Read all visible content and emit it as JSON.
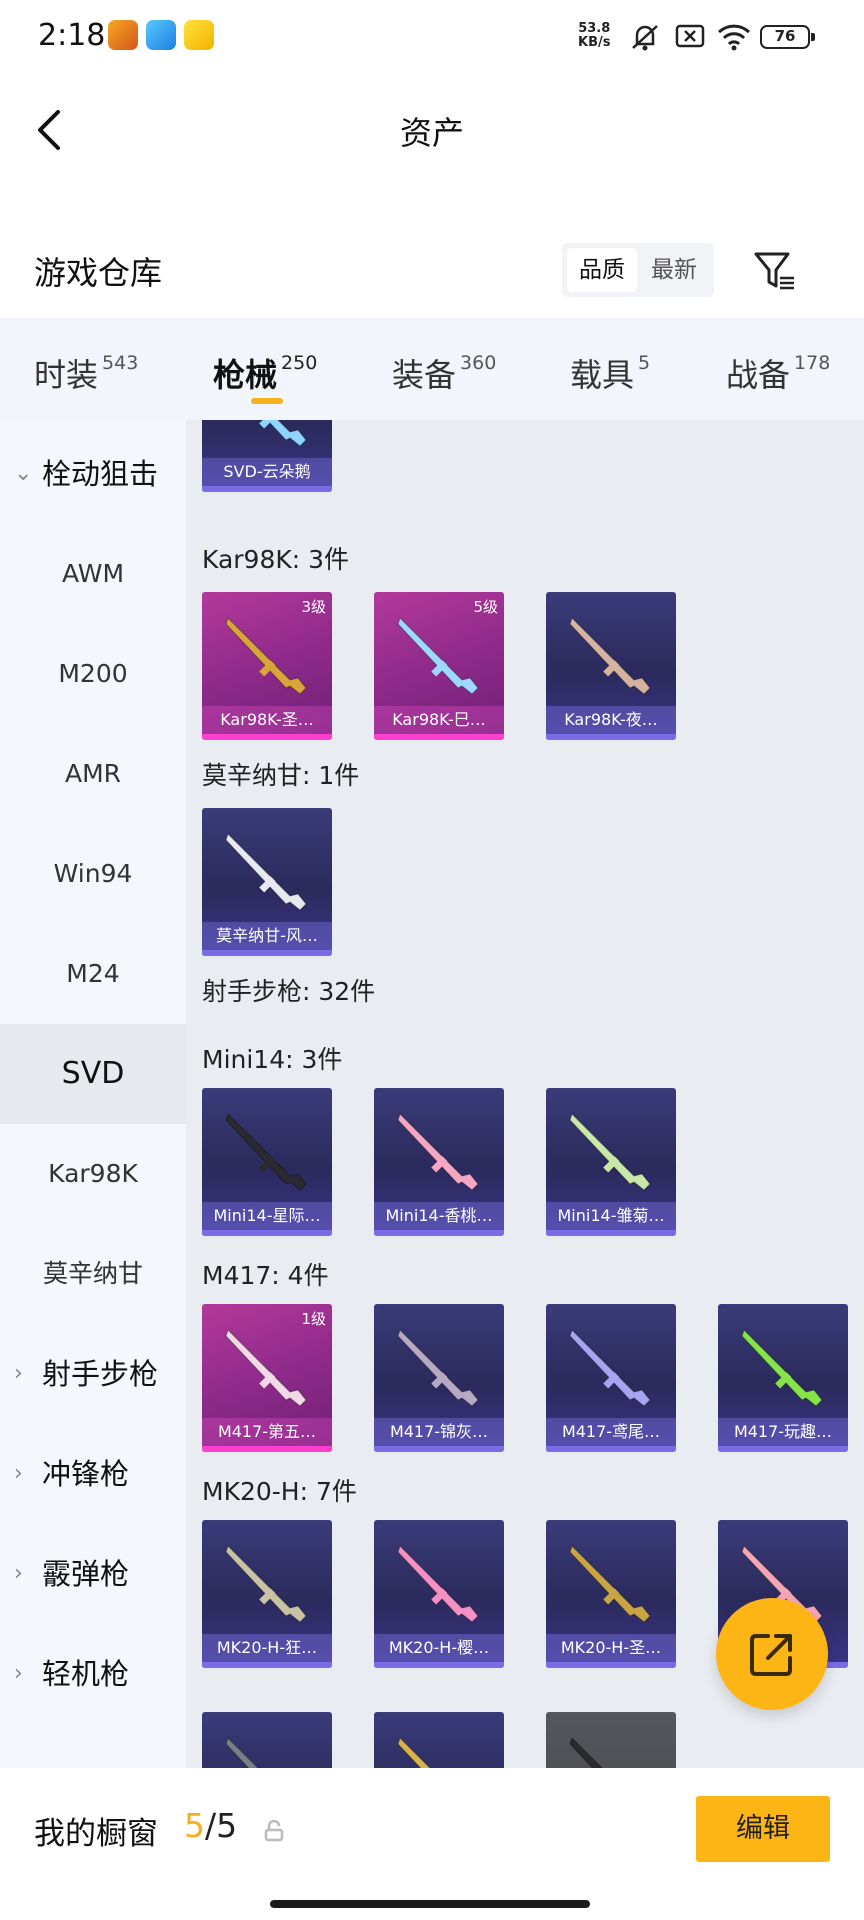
{
  "status_bar": {
    "time": "2:18",
    "net_speed_value": "53.8",
    "net_speed_unit": "KB/s",
    "battery": "76"
  },
  "header": {
    "title": "资产"
  },
  "warehouse": {
    "title": "游戏仓库",
    "sort_options": [
      "品质",
      "最新"
    ],
    "sort_active": "品质"
  },
  "tabs": [
    {
      "label": "时装",
      "count": "543"
    },
    {
      "label": "枪械",
      "count": "250",
      "active": true
    },
    {
      "label": "装备",
      "count": "360"
    },
    {
      "label": "载具",
      "count": "5"
    },
    {
      "label": "战备",
      "count": "178"
    }
  ],
  "sidebar": [
    {
      "label": "栓动狙击",
      "type": "group"
    },
    {
      "label": "AWM"
    },
    {
      "label": "M200"
    },
    {
      "label": "AMR"
    },
    {
      "label": "Win94"
    },
    {
      "label": "M24"
    },
    {
      "label": "SVD",
      "active": true
    },
    {
      "label": "Kar98K"
    },
    {
      "label": "莫辛纳甘"
    },
    {
      "label": "射手步枪",
      "type": "group"
    },
    {
      "label": "冲锋枪",
      "type": "group"
    },
    {
      "label": "霰弹枪",
      "type": "group"
    },
    {
      "label": "轻机枪",
      "type": "group"
    }
  ],
  "content": {
    "labels": [
      "Kar98K: 3件",
      "莫辛纳甘: 1件",
      "射手步枪: 32件",
      "Mini14: 3件",
      "M417: 4件",
      "MK20-H: 7件"
    ],
    "cards": [
      {
        "name": "SVD-云朵鹅",
        "style": "purple",
        "color": "#8fd3ff"
      },
      {
        "name": "Kar98K-圣…",
        "style": "pink",
        "level": "3级",
        "color": "#d9a43a"
      },
      {
        "name": "Kar98K-巳…",
        "style": "pink",
        "level": "5级",
        "color": "#9fd8ff"
      },
      {
        "name": "Kar98K-夜…",
        "style": "purple",
        "color": "#d6b2a0"
      },
      {
        "name": "莫辛纳甘-风…",
        "style": "purple",
        "color": "#e8e8f0"
      },
      {
        "name": "Mini14-星际…",
        "style": "purple",
        "color": "#2a2a30"
      },
      {
        "name": "Mini14-香桃…",
        "style": "purple",
        "color": "#f4a7c2"
      },
      {
        "name": "Mini14-雏菊…",
        "style": "purple",
        "color": "#c9e8a8"
      },
      {
        "name": "M417-第五…",
        "style": "pink",
        "level": "1级",
        "color": "#f3d9e6"
      },
      {
        "name": "M417-锦灰…",
        "style": "purple",
        "color": "#b7a9c4"
      },
      {
        "name": "M417-鸢尾…",
        "style": "purple",
        "color": "#a7a4f0"
      },
      {
        "name": "M417-玩趣…",
        "style": "purple",
        "color": "#86e34a"
      },
      {
        "name": "MK20-H-狂…",
        "style": "purple",
        "color": "#c9c3a6"
      },
      {
        "name": "MK20-H-樱…",
        "style": "purple",
        "color": "#f490c2"
      },
      {
        "name": "MK20-H-圣…",
        "style": "purple",
        "color": "#c9a443"
      },
      {
        "name": "",
        "style": "purple",
        "color": "#f3a7b5"
      },
      {
        "name": "",
        "style": "purple",
        "color": "#778088"
      },
      {
        "name": "",
        "style": "purple",
        "color": "#d9b24a"
      },
      {
        "name": "",
        "style": "gray",
        "color": "#2b2b2b"
      }
    ]
  },
  "bottom": {
    "label": "我的橱窗",
    "current": "5",
    "separator_total": "/5",
    "edit_label": "编辑"
  }
}
